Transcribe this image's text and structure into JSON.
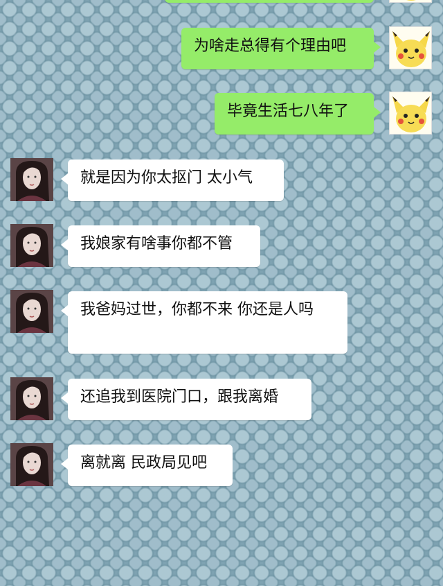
{
  "conversation": {
    "messages": [
      {
        "side": "sent",
        "text": "为啥走总得有个理由吧",
        "avatar_icon": "pikachu-avatar-icon"
      },
      {
        "side": "sent",
        "text": "毕竟生活七八年了",
        "avatar_icon": "pikachu-avatar-icon"
      },
      {
        "side": "received",
        "text": "就是因为你太抠门 太小气",
        "avatar_icon": "woman-avatar-icon"
      },
      {
        "side": "received",
        "text": "我娘家有啥事你都不管",
        "avatar_icon": "woman-avatar-icon"
      },
      {
        "side": "received",
        "text": "我爸妈过世，你都不来 你还是人吗",
        "avatar_icon": "woman-avatar-icon"
      },
      {
        "side": "received",
        "text": "还追我到医院门口，跟我离婚",
        "avatar_icon": "woman-avatar-icon"
      },
      {
        "side": "received",
        "text": "离就离 民政局见吧",
        "avatar_icon": "woman-avatar-icon"
      }
    ]
  },
  "colors": {
    "sent_bubble": "#95ec69",
    "received_bubble": "#ffffff",
    "background": "#7fa3b2"
  }
}
